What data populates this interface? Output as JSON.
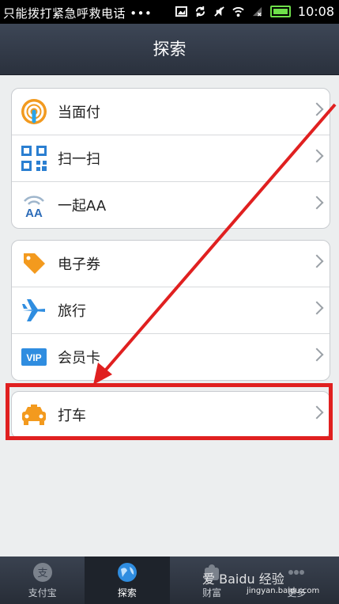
{
  "status_bar": {
    "notice": "只能拨打紧急呼救电话 •••",
    "time": "10:08",
    "icons": [
      "image-icon",
      "sync-icon",
      "mute-icon",
      "wifi-icon",
      "no-signal-icon",
      "battery-icon"
    ]
  },
  "header": {
    "title": "探索"
  },
  "groups": [
    {
      "items": [
        {
          "label": "当面付",
          "icon": "pay-face-icon"
        },
        {
          "label": "扫一扫",
          "icon": "qr-scan-icon"
        },
        {
          "label": "一起AA",
          "icon": "aa-icon"
        }
      ]
    },
    {
      "items": [
        {
          "label": "电子券",
          "icon": "coupon-icon"
        },
        {
          "label": "旅行",
          "icon": "plane-icon"
        },
        {
          "label": "会员卡",
          "icon": "vip-card-icon"
        }
      ]
    },
    {
      "items": [
        {
          "label": "打车",
          "icon": "taxi-icon"
        }
      ]
    }
  ],
  "vip_badge": "VIP",
  "tabbar": {
    "tabs": [
      {
        "label": "支付宝",
        "icon": "alipay-icon",
        "active": false
      },
      {
        "label": "探索",
        "icon": "globe-icon",
        "active": true
      },
      {
        "label": "财富",
        "icon": "wealth-icon",
        "active": false
      },
      {
        "label": "更多",
        "icon": "more-icon",
        "active": false
      }
    ]
  },
  "watermark": {
    "text": "爱 Baidu 经验",
    "url": "jingyan.baidu.com"
  },
  "colors": {
    "highlight": "#e02020",
    "alipay_blue": "#1a7fd6",
    "taxi_orange": "#f39a1e"
  }
}
